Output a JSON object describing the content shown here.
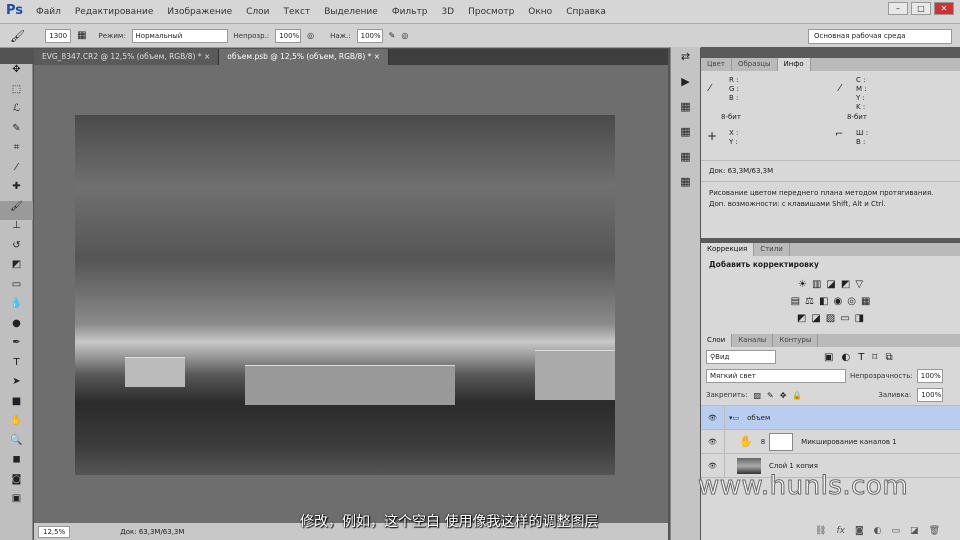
{
  "app": {
    "logo": "Ps",
    "menu": [
      "Файл",
      "Редактирование",
      "Изображение",
      "Слои",
      "Текст",
      "Выделение",
      "Фильтр",
      "3D",
      "Просмотр",
      "Окно",
      "Справка"
    ],
    "window_buttons": [
      "–",
      "□",
      "✕"
    ]
  },
  "options": {
    "brush_size": "1300",
    "mode_label": "Режим:",
    "mode_value": "Нормальный",
    "opacity_label": "Непрозр.:",
    "opacity_value": "100%",
    "flow_label": "Наж.:",
    "flow_value": "100%",
    "workspace": "Основная рабочая среда"
  },
  "doc_tabs": [
    {
      "label": "EVG_8347.CR2 @ 12,5% (объем, RGB/8) *",
      "close": "×"
    },
    {
      "label": "объем.psb @ 12,5% (объем, RGB/8) *",
      "close": "×"
    }
  ],
  "status": {
    "zoom": "12,5%",
    "doc": "Док: 63,3M/63,3M"
  },
  "info_panel": {
    "tabs": [
      "Цвет",
      "Образцы",
      "Инфо"
    ],
    "rgb": [
      "R :",
      "G :",
      "B :"
    ],
    "cmyk": [
      "C :",
      "M :",
      "Y :",
      "K :"
    ],
    "bits_left": "8-бит",
    "bits_right": "8-бит",
    "xy": [
      "X :",
      "Y :"
    ],
    "wh": [
      "Ш :",
      "В :"
    ],
    "doc": "Док: 63,3M/63,3M",
    "hint": "Рисование цветом переднего плана методом протягивания. Доп. возможности: с клавишами Shift, Alt и Ctrl."
  },
  "adjust_panel": {
    "tabs": [
      "Коррекция",
      "Стили"
    ],
    "title": "Добавить корректировку"
  },
  "layers_panel": {
    "tabs": [
      "Слои",
      "Каналы",
      "Контуры"
    ],
    "filter": "Вид",
    "blend": "Мягкий свет",
    "opacity_label": "Непрозрачность:",
    "opacity": "100%",
    "lock_label": "Закрепить:",
    "fill_label": "Заливка:",
    "fill": "100%",
    "layers": [
      {
        "name": "объем",
        "selected": true
      },
      {
        "name": "Микширование каналов 1"
      },
      {
        "name": "Слой 1 копия"
      }
    ],
    "footer_icons": [
      "link-icon",
      "fx-icon",
      "mask-icon",
      "adjustment-icon",
      "folder-icon",
      "new-layer-icon",
      "trash-icon"
    ]
  },
  "subtitle": "修改，例如，这个空白 使用像我这样的调整图层",
  "watermark": "www.hunls.com"
}
